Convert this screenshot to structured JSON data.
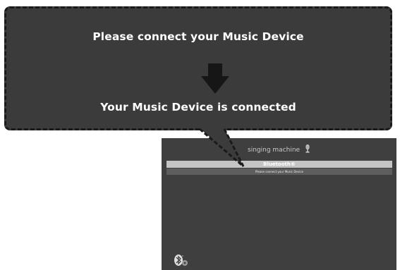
{
  "callout": {
    "instruction": "Please connect your Music Device",
    "result": "Your Music Device is connected"
  },
  "screen": {
    "brand": "singing machine",
    "bluetooth_header": "Bluetooth®",
    "status_message": "Please connect your Music Device"
  },
  "icons": {
    "arrow": "down-arrow-icon",
    "microphone": "microphone-icon",
    "bluetooth": "bluetooth-icon"
  },
  "colors": {
    "callout_bg": "#3b3b3b",
    "screen_bg": "#3f3f3f",
    "header_bar": "#c4c4c4",
    "status_bar": "#5e5e5e"
  }
}
